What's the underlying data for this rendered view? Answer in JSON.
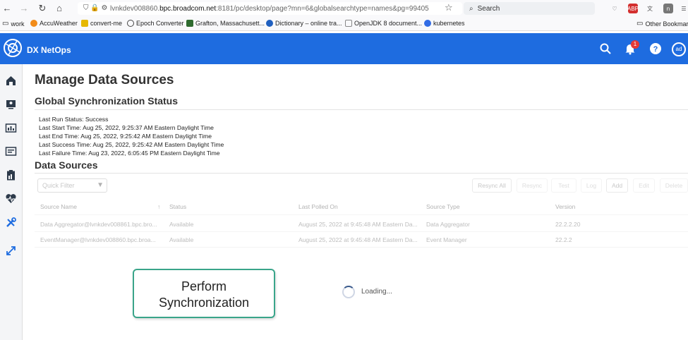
{
  "browser": {
    "url_prefix": "lvnkdev008860.",
    "url_host": "bpc.broadcom.net",
    "url_rest": ":8181/pc/desktop/page?mn=6&globalsearchtype=names&pg=99405",
    "search_placeholder": "Search",
    "ext_abp": "ABP",
    "bookmarks": [
      {
        "label": "work",
        "color": "#7a7a7a"
      },
      {
        "label": "AccuWeather",
        "color": "#f28c1b"
      },
      {
        "label": "convert-me",
        "color": "#e6b800"
      },
      {
        "label": "Epoch Converter",
        "color": "#444444"
      },
      {
        "label": "Grafton, Massachusett...",
        "color": "#2f6b2f"
      },
      {
        "label": "Dictionary – online tra...",
        "color": "#1f5fbf"
      },
      {
        "label": "OpenJDK 8 document...",
        "color": "#888888"
      },
      {
        "label": "kubernetes",
        "color": "#326ce5"
      }
    ],
    "other_bookmarks": "Other Bookmarks"
  },
  "app": {
    "title": "DX NetOps",
    "notification_count": "1",
    "avatar_initials": "ad",
    "brand_color": "#1e6ce0"
  },
  "rail": {
    "icons": [
      "home-icon",
      "dashboard-icon",
      "report-icon",
      "inventory-icon",
      "clipboard-icon",
      "health-icon",
      "tools-icon",
      "expand-icon"
    ]
  },
  "page": {
    "title": "Manage Data Sources",
    "sync_title": "Global Synchronization Status",
    "status_lines": [
      "Last Run Status: Success",
      "Last Start Time: Aug 25, 2022, 9:25:37 AM Eastern Daylight Time",
      "Last End Time: Aug 25, 2022, 9:25:42 AM Eastern Daylight Time",
      "Last Success Time: Aug 25, 2022, 9:25:42 AM Eastern Daylight Time",
      "Last Failure Time: Aug 23, 2022, 6:05:45 PM Eastern Daylight Time"
    ],
    "ds_title": "Data Sources",
    "filter_placeholder": "Quick Filter",
    "buttons": [
      "Resync All",
      "Resync",
      "Test",
      "Log",
      "Add",
      "Edit",
      "Delete"
    ],
    "columns": [
      "Source Name",
      "Status",
      "Last Polled On",
      "Source Type",
      "Version"
    ],
    "rows": [
      [
        "Data Aggregator@lvnkdev008861.bpc.bro...",
        "Available",
        "August 25, 2022 at 9:45:48 AM Eastern Da...",
        "Data Aggregator",
        "22.2.2.20"
      ],
      [
        "EventManager@lvnkdev008860.bpc.broa...",
        "Available",
        "August 25, 2022 at 9:45:48 AM Eastern Da...",
        "Event Manager",
        "22.2.2"
      ]
    ],
    "loading_text": "Loading...",
    "callout_line1": "Perform",
    "callout_line2": "Synchronization"
  }
}
